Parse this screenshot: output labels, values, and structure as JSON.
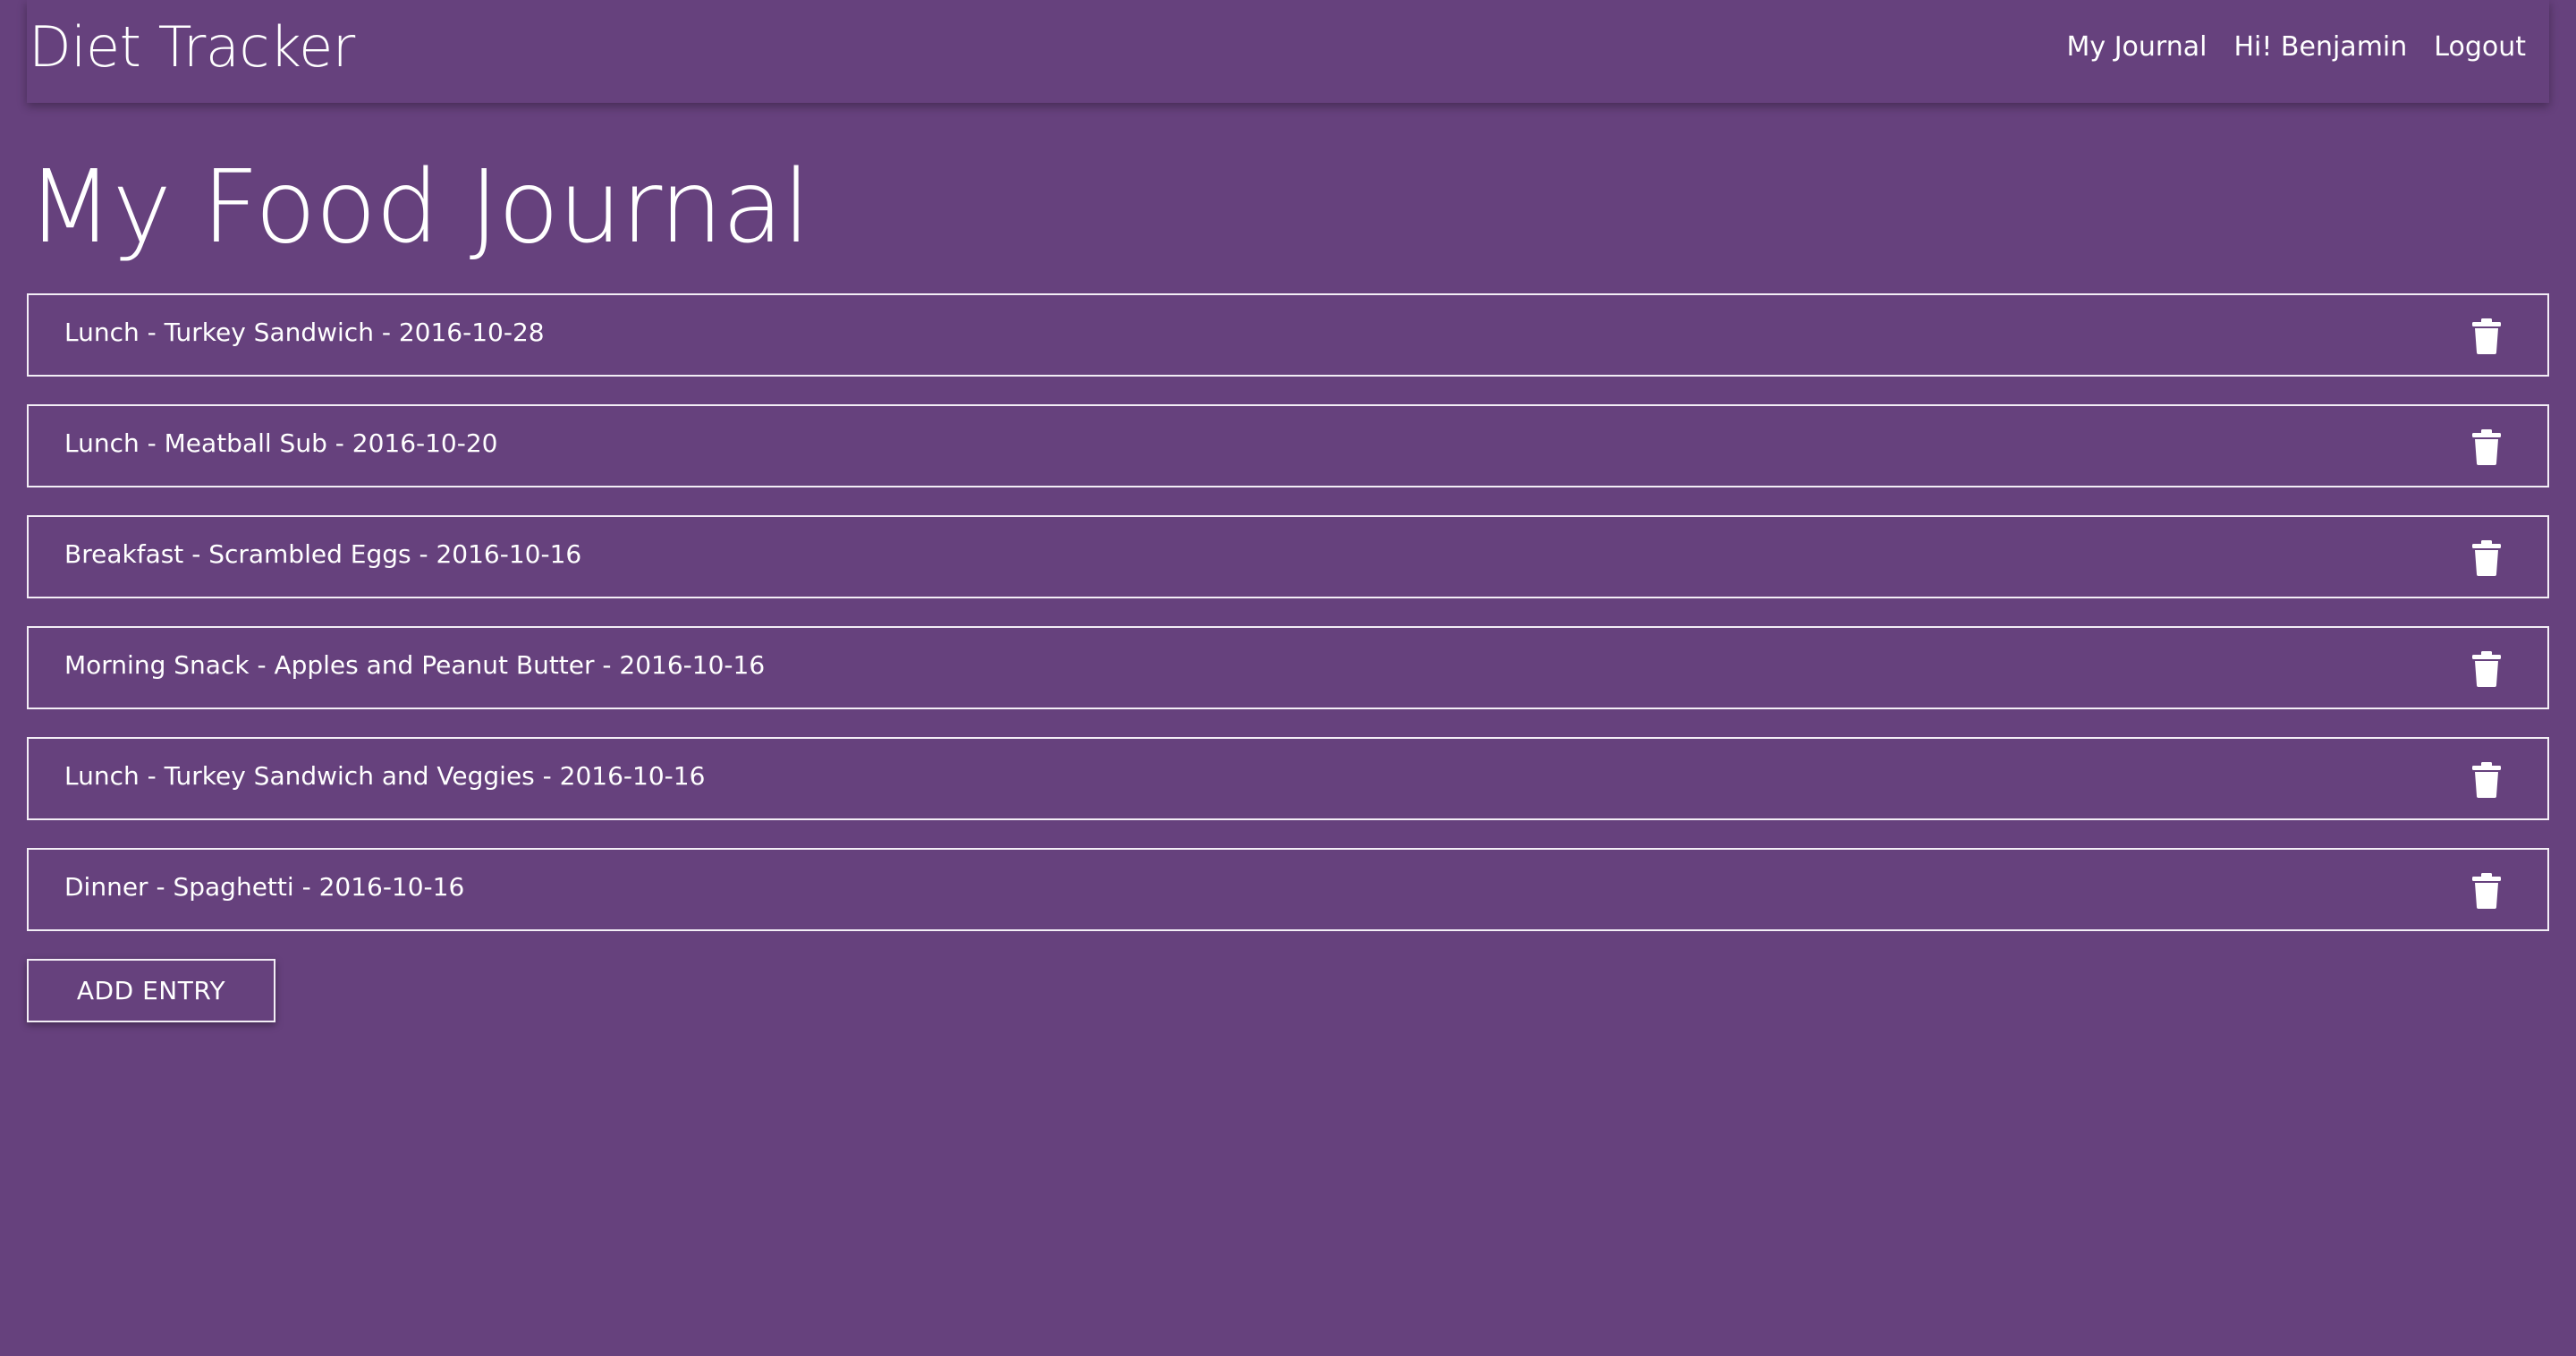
{
  "navbar": {
    "brand": "Diet Tracker",
    "links": [
      {
        "label": "My Journal"
      },
      {
        "label": "Hi! Benjamin"
      },
      {
        "label": "Logout"
      }
    ]
  },
  "main": {
    "title": "My Food Journal",
    "entries": [
      {
        "text": "Lunch - Turkey Sandwich - 2016-10-28",
        "delete_icon": "trash-icon"
      },
      {
        "text": "Lunch - Meatball Sub - 2016-10-20",
        "delete_icon": "trash-icon"
      },
      {
        "text": "Breakfast - Scrambled Eggs - 2016-10-16",
        "delete_icon": "trash-icon"
      },
      {
        "text": "Morning Snack - Apples and Peanut Butter - 2016-10-16",
        "delete_icon": "trash-icon"
      },
      {
        "text": "Lunch - Turkey Sandwich and Veggies - 2016-10-16",
        "delete_icon": "trash-icon"
      },
      {
        "text": "Dinner - Spaghetti - 2016-10-16",
        "delete_icon": "trash-icon"
      }
    ],
    "add_button_label": "ADD ENTRY"
  },
  "colors": {
    "background": "#66417d",
    "text": "#ffffff",
    "border": "#f3eef6"
  }
}
